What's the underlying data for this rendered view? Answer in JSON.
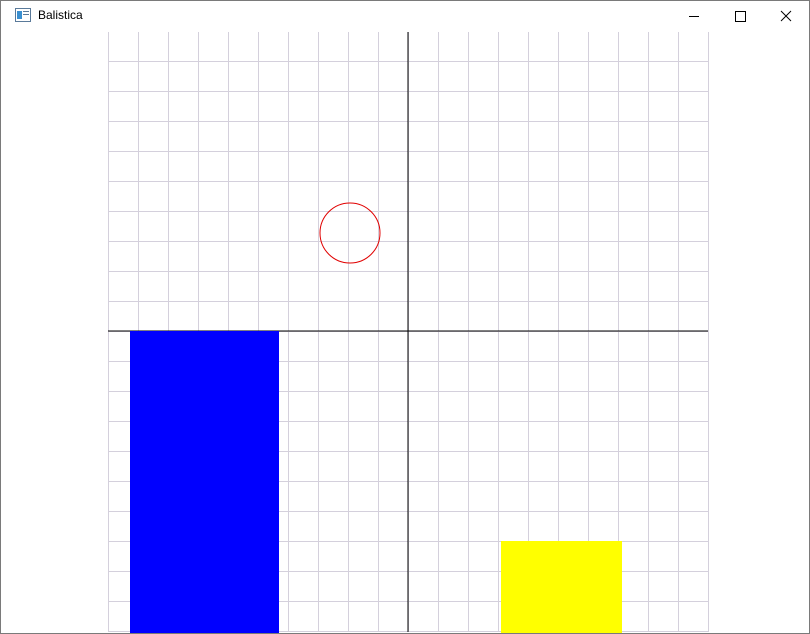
{
  "window": {
    "title": "Balistica"
  },
  "titlebar_buttons": [
    {
      "name": "minimize-button",
      "icon": "minimize-icon"
    },
    {
      "name": "maximize-button",
      "icon": "maximize-icon"
    },
    {
      "name": "close-button",
      "icon": "close-icon"
    }
  ],
  "scene": {
    "grid_color": "#d4d0dc",
    "axis_color": "#000000",
    "target_circle_color": "#e00000",
    "left_block_color": "#0000ff",
    "right_block_color": "#ffff00"
  }
}
